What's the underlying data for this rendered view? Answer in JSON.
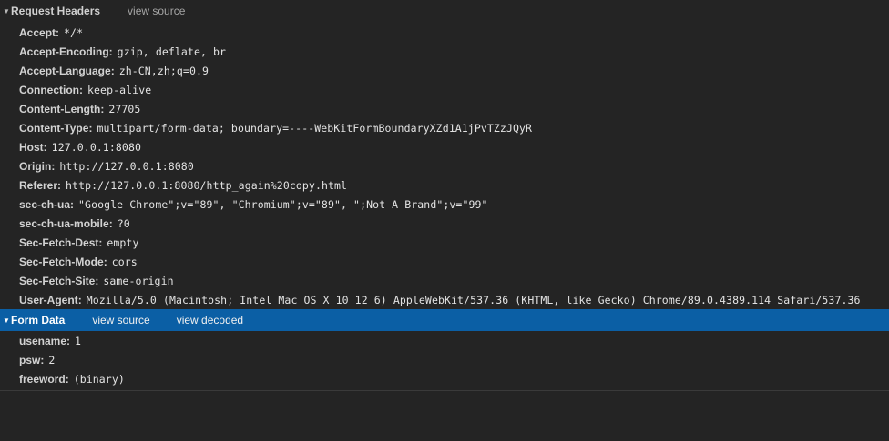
{
  "request_headers": {
    "title": "Request Headers",
    "view_source": "view source",
    "items": [
      {
        "name": "Accept",
        "value": "*/*"
      },
      {
        "name": "Accept-Encoding",
        "value": "gzip, deflate, br"
      },
      {
        "name": "Accept-Language",
        "value": "zh-CN,zh;q=0.9"
      },
      {
        "name": "Connection",
        "value": "keep-alive"
      },
      {
        "name": "Content-Length",
        "value": "27705"
      },
      {
        "name": "Content-Type",
        "value": "multipart/form-data; boundary=----WebKitFormBoundaryXZd1A1jPvTZzJQyR"
      },
      {
        "name": "Host",
        "value": "127.0.0.1:8080"
      },
      {
        "name": "Origin",
        "value": "http://127.0.0.1:8080"
      },
      {
        "name": "Referer",
        "value": "http://127.0.0.1:8080/http_again%20copy.html"
      },
      {
        "name": "sec-ch-ua",
        "value": "\"Google Chrome\";v=\"89\", \"Chromium\";v=\"89\", \";Not A Brand\";v=\"99\""
      },
      {
        "name": "sec-ch-ua-mobile",
        "value": "?0"
      },
      {
        "name": "Sec-Fetch-Dest",
        "value": "empty"
      },
      {
        "name": "Sec-Fetch-Mode",
        "value": "cors"
      },
      {
        "name": "Sec-Fetch-Site",
        "value": "same-origin"
      },
      {
        "name": "User-Agent",
        "value": "Mozilla/5.0 (Macintosh; Intel Mac OS X 10_12_6) AppleWebKit/537.36 (KHTML, like Gecko) Chrome/89.0.4389.114 Safari/537.36"
      }
    ]
  },
  "form_data": {
    "title": "Form Data",
    "view_source": "view source",
    "view_decoded": "view decoded",
    "items": [
      {
        "name": "usename",
        "value": "1"
      },
      {
        "name": "psw",
        "value": "2"
      },
      {
        "name": "freeword",
        "value": "(binary)"
      }
    ]
  },
  "colors": {
    "background": "#242424",
    "selected_section": "#0b5fa5",
    "text": "#d6d6d6",
    "link": "#a5a5a5"
  },
  "icons": {
    "expand": "triangle-down-icon"
  }
}
